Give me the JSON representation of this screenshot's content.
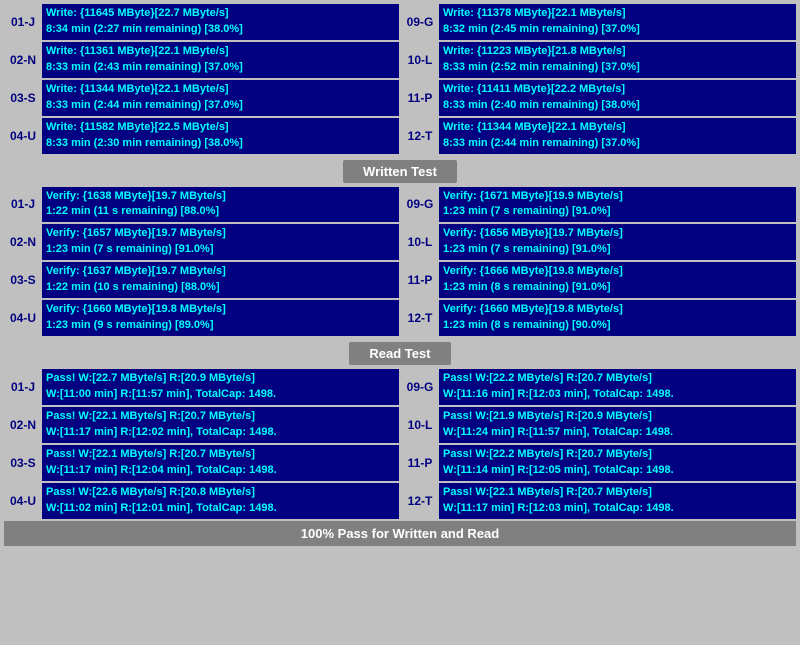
{
  "writeSection": {
    "left": [
      {
        "id": "01-J",
        "line1": "Write: {11645 MByte}[22.7 MByte/s]",
        "line2": "8:34 min (2:27 min remaining)  [38.0%]"
      },
      {
        "id": "02-N",
        "line1": "Write: {11361 MByte}[22.1 MByte/s]",
        "line2": "8:33 min (2:43 min remaining)  [37.0%]"
      },
      {
        "id": "03-S",
        "line1": "Write: {11344 MByte}[22.1 MByte/s]",
        "line2": "8:33 min (2:44 min remaining)  [37.0%]"
      },
      {
        "id": "04-U",
        "line1": "Write: {11582 MByte}[22.5 MByte/s]",
        "line2": "8:33 min (2:30 min remaining)  [38.0%]"
      }
    ],
    "right": [
      {
        "id": "09-G",
        "line1": "Write: {11378 MByte}[22.1 MByte/s]",
        "line2": "8:32 min (2:45 min remaining)  [37.0%]"
      },
      {
        "id": "10-L",
        "line1": "Write: {11223 MByte}[21.8 MByte/s]",
        "line2": "8:33 min (2:52 min remaining)  [37.0%]"
      },
      {
        "id": "11-P",
        "line1": "Write: {11411 MByte}[22.2 MByte/s]",
        "line2": "8:33 min (2:40 min remaining)  [38.0%]"
      },
      {
        "id": "12-T",
        "line1": "Write: {11344 MByte}[22.1 MByte/s]",
        "line2": "8:33 min (2:44 min remaining)  [37.0%]"
      }
    ],
    "label": "Written Test"
  },
  "verifySection": {
    "left": [
      {
        "id": "01-J",
        "line1": "Verify: {1638 MByte}[19.7 MByte/s]",
        "line2": "1:22 min (11 s remaining)  [88.0%]"
      },
      {
        "id": "02-N",
        "line1": "Verify: {1657 MByte}[19.7 MByte/s]",
        "line2": "1:23 min (7 s remaining)  [91.0%]"
      },
      {
        "id": "03-S",
        "line1": "Verify: {1637 MByte}[19.7 MByte/s]",
        "line2": "1:22 min (10 s remaining)  [88.0%]"
      },
      {
        "id": "04-U",
        "line1": "Verify: {1660 MByte}[19.8 MByte/s]",
        "line2": "1:23 min (9 s remaining)  [89.0%]"
      }
    ],
    "right": [
      {
        "id": "09-G",
        "line1": "Verify: {1671 MByte}[19.9 MByte/s]",
        "line2": "1:23 min (7 s remaining)  [91.0%]"
      },
      {
        "id": "10-L",
        "line1": "Verify: {1656 MByte}[19.7 MByte/s]",
        "line2": "1:23 min (7 s remaining)  [91.0%]"
      },
      {
        "id": "11-P",
        "line1": "Verify: {1666 MByte}[19.8 MByte/s]",
        "line2": "1:23 min (8 s remaining)  [91.0%]"
      },
      {
        "id": "12-T",
        "line1": "Verify: {1660 MByte}[19.8 MByte/s]",
        "line2": "1:23 min (8 s remaining)  [90.0%]"
      }
    ],
    "label": "Read Test"
  },
  "readSection": {
    "left": [
      {
        "id": "01-J",
        "line1": "Pass! W:[22.7 MByte/s] R:[20.9 MByte/s]",
        "line2": "W:[11:00 min] R:[11:57 min], TotalCap: 1498."
      },
      {
        "id": "02-N",
        "line1": "Pass! W:[22.1 MByte/s] R:[20.7 MByte/s]",
        "line2": "W:[11:17 min] R:[12:02 min], TotalCap: 1498."
      },
      {
        "id": "03-S",
        "line1": "Pass! W:[22.1 MByte/s] R:[20.7 MByte/s]",
        "line2": "W:[11:17 min] R:[12:04 min], TotalCap: 1498."
      },
      {
        "id": "04-U",
        "line1": "Pass! W:[22.6 MByte/s] R:[20.8 MByte/s]",
        "line2": "W:[11:02 min] R:[12:01 min], TotalCap: 1498."
      }
    ],
    "right": [
      {
        "id": "09-G",
        "line1": "Pass! W:[22.2 MByte/s] R:[20.7 MByte/s]",
        "line2": "W:[11:16 min] R:[12:03 min], TotalCap: 1498."
      },
      {
        "id": "10-L",
        "line1": "Pass! W:[21.9 MByte/s] R:[20.9 MByte/s]",
        "line2": "W:[11:24 min] R:[11:57 min], TotalCap: 1498."
      },
      {
        "id": "11-P",
        "line1": "Pass! W:[22.2 MByte/s] R:[20.7 MByte/s]",
        "line2": "W:[11:14 min] R:[12:05 min], TotalCap: 1498."
      },
      {
        "id": "12-T",
        "line1": "Pass! W:[22.1 MByte/s] R:[20.7 MByte/s]",
        "line2": "W:[11:17 min] R:[12:03 min], TotalCap: 1498."
      }
    ]
  },
  "bottomBar": "100% Pass for Written and Read"
}
